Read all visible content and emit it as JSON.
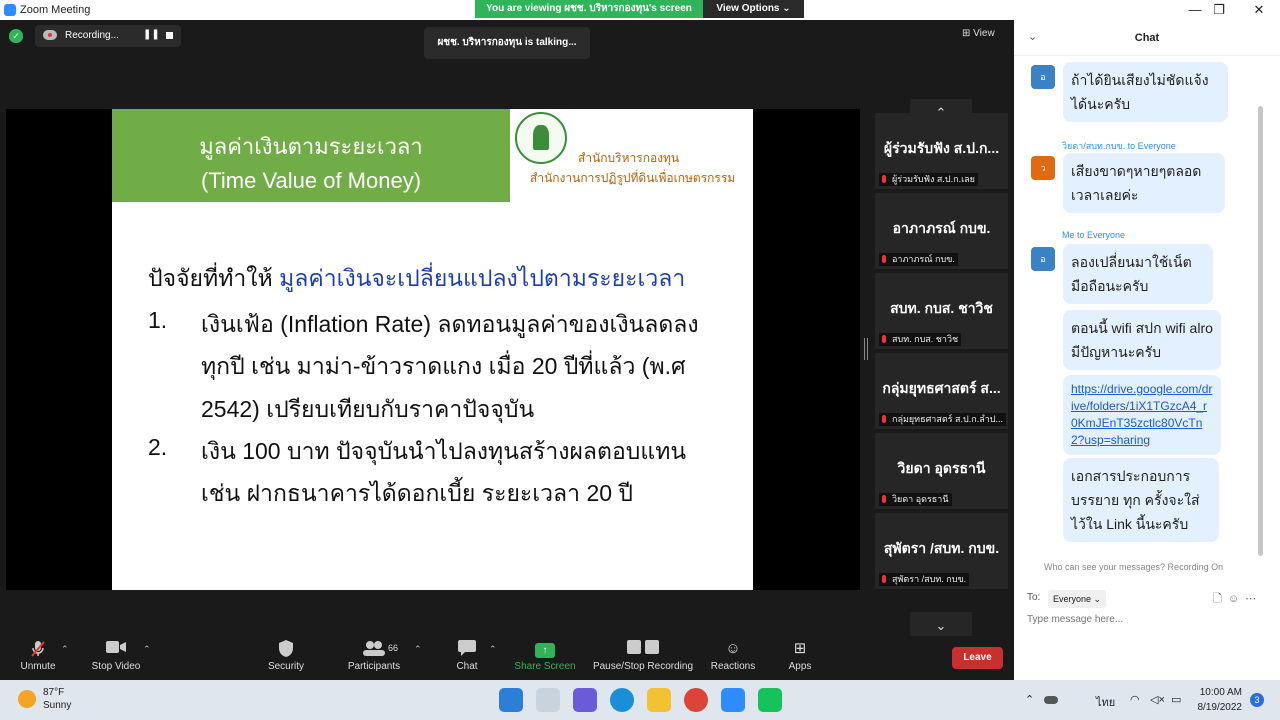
{
  "window": {
    "title": "Zoom Meeting",
    "banner": "You are viewing ผชช. บริหารกองทุน's screen",
    "view_options": "View Options ⌄",
    "minimize": "—",
    "maximize": "❐",
    "close": "✕"
  },
  "meeting": {
    "recording_label": "Recording...",
    "pause_icon": "❚❚",
    "talking": "ผชช. บริหารกองทุน is talking...",
    "view_label": "View",
    "view_icon": "⊞"
  },
  "slide": {
    "title_th": "มูลค่าเงินตามระยะเวลา",
    "title_en": "(Time Value of Money)",
    "office_1": "สำนักบริหารกองทุน",
    "office_2": "สำนักงานการปฏิรูปที่ดินเพื่อเกษตรกรรม",
    "heading_prefix": "ปัจจัยที่ทำให้ ",
    "heading_highlight": "มูลค่าเงินจะเปลี่ยนแปลงไปตามระยะเวลา",
    "items": [
      {
        "num": "1.",
        "lines": [
          "เงินเฟ้อ (Inflation Rate) ลดทอนมูลค่าของเงินลดลง",
          "ทุกปี เช่น มาม่า-ข้าวราดแกง เมื่อ 20 ปีที่แล้ว  (พ.ศ",
          "2542) เปรียบเทียบกับราคาปัจจุบัน"
        ]
      },
      {
        "num": "2.",
        "lines": [
          "เงิน 100 บาท ปัจจุบันนำไปลงทุนสร้างผลตอบแทน",
          "เช่น ฝากธนาคารได้ดอกเบี้ย ระยะเวลา 20 ปี"
        ]
      }
    ]
  },
  "gallery": {
    "up": "⌃",
    "down": "⌄",
    "tiles": [
      {
        "name": "ผู้ร่วมรับฟัง ส.ป.ก...",
        "label": "ผู้ร่วมรับฟัง ส.ป.ก.เลย"
      },
      {
        "name": "อาภาภรณ์ กบข.",
        "label": "อาภาภรณ์ กบข."
      },
      {
        "name": "สบท. กบส. ชาวิช",
        "label": "สบท. กบส. ชาวิช"
      },
      {
        "name": "กลุ่มยุทธศาสตร์ ส...",
        "label": "กลุ่มยุทธศาสตร์ ส.ป.ก.ลำป..."
      },
      {
        "name": "วิยดา อุดรธานี",
        "label": "วิยดา อุดรธานี"
      },
      {
        "name": "สุพัตรา /สบท. กบข.",
        "label": "สุพัตรา /สบท. กบข."
      }
    ]
  },
  "toolbar": {
    "unmute": "Unmute",
    "stop_video": "Stop Video",
    "security": "Security",
    "participants": "Participants",
    "participant_count": "66",
    "chat": "Chat",
    "share_screen": "Share Screen",
    "pause_stop_recording": "Pause/Stop Recording",
    "reactions": "Reactions",
    "apps": "Apps",
    "leave": "Leave",
    "caret": "⌃"
  },
  "chat": {
    "title": "Chat",
    "collapse": "⌄",
    "messages": [
      {
        "avatar": "อ",
        "sender": "",
        "text": "ถ้าได้ยินเสียงไม่ชัดแจ้ง ได้นะครับ"
      },
      {
        "avatar": "ว",
        "sender": "วิยดา/สบท.กบข. to Everyone",
        "text": "เสียงขาดๆหายๆตลอด เวลาเลยค่ะ"
      },
      {
        "avatar": "อ",
        "sender": "Me to Everyone",
        "text": "ลองเปลี่ยนมาใช้เน็ต มือถือนะครับ"
      },
      {
        "avatar": "",
        "sender": "",
        "text": "ตอนนี้ wifi สปก wifi alro มีปัญหานะครับ"
      },
      {
        "avatar": "",
        "sender": "",
        "text": "https://drive.google.com/drive/folders/1iX1TGzcA4_r0KmJEnT35zctlc80VcTn2?usp=sharing"
      },
      {
        "avatar": "",
        "sender": "",
        "text": "เอกสารประกอบการ บรรยาย ทุก ครั้งจะใส่ ไว้ใน Link นี้นะครับ"
      }
    ],
    "privacy": "Who can see your messages? Recording On",
    "to_label": "To:",
    "to_value": "Everyone ⌄",
    "tools": "🗋☺⋯",
    "input_placeholder": "Type message here..."
  },
  "taskbar": {
    "temperature": "87°F",
    "condition": "Sunny",
    "time": "10:00 AM",
    "date": "8/19/2022",
    "language": "ไทย",
    "notification_count": "3",
    "tray_arrow": "⌃"
  },
  "colors": {
    "slide_title_bg": "#70ad47",
    "heading_highlight": "#1f3fb0",
    "leave": "#c8302d",
    "share_green": "#2fb45a",
    "chat_bubble": "#e3f0ff"
  }
}
